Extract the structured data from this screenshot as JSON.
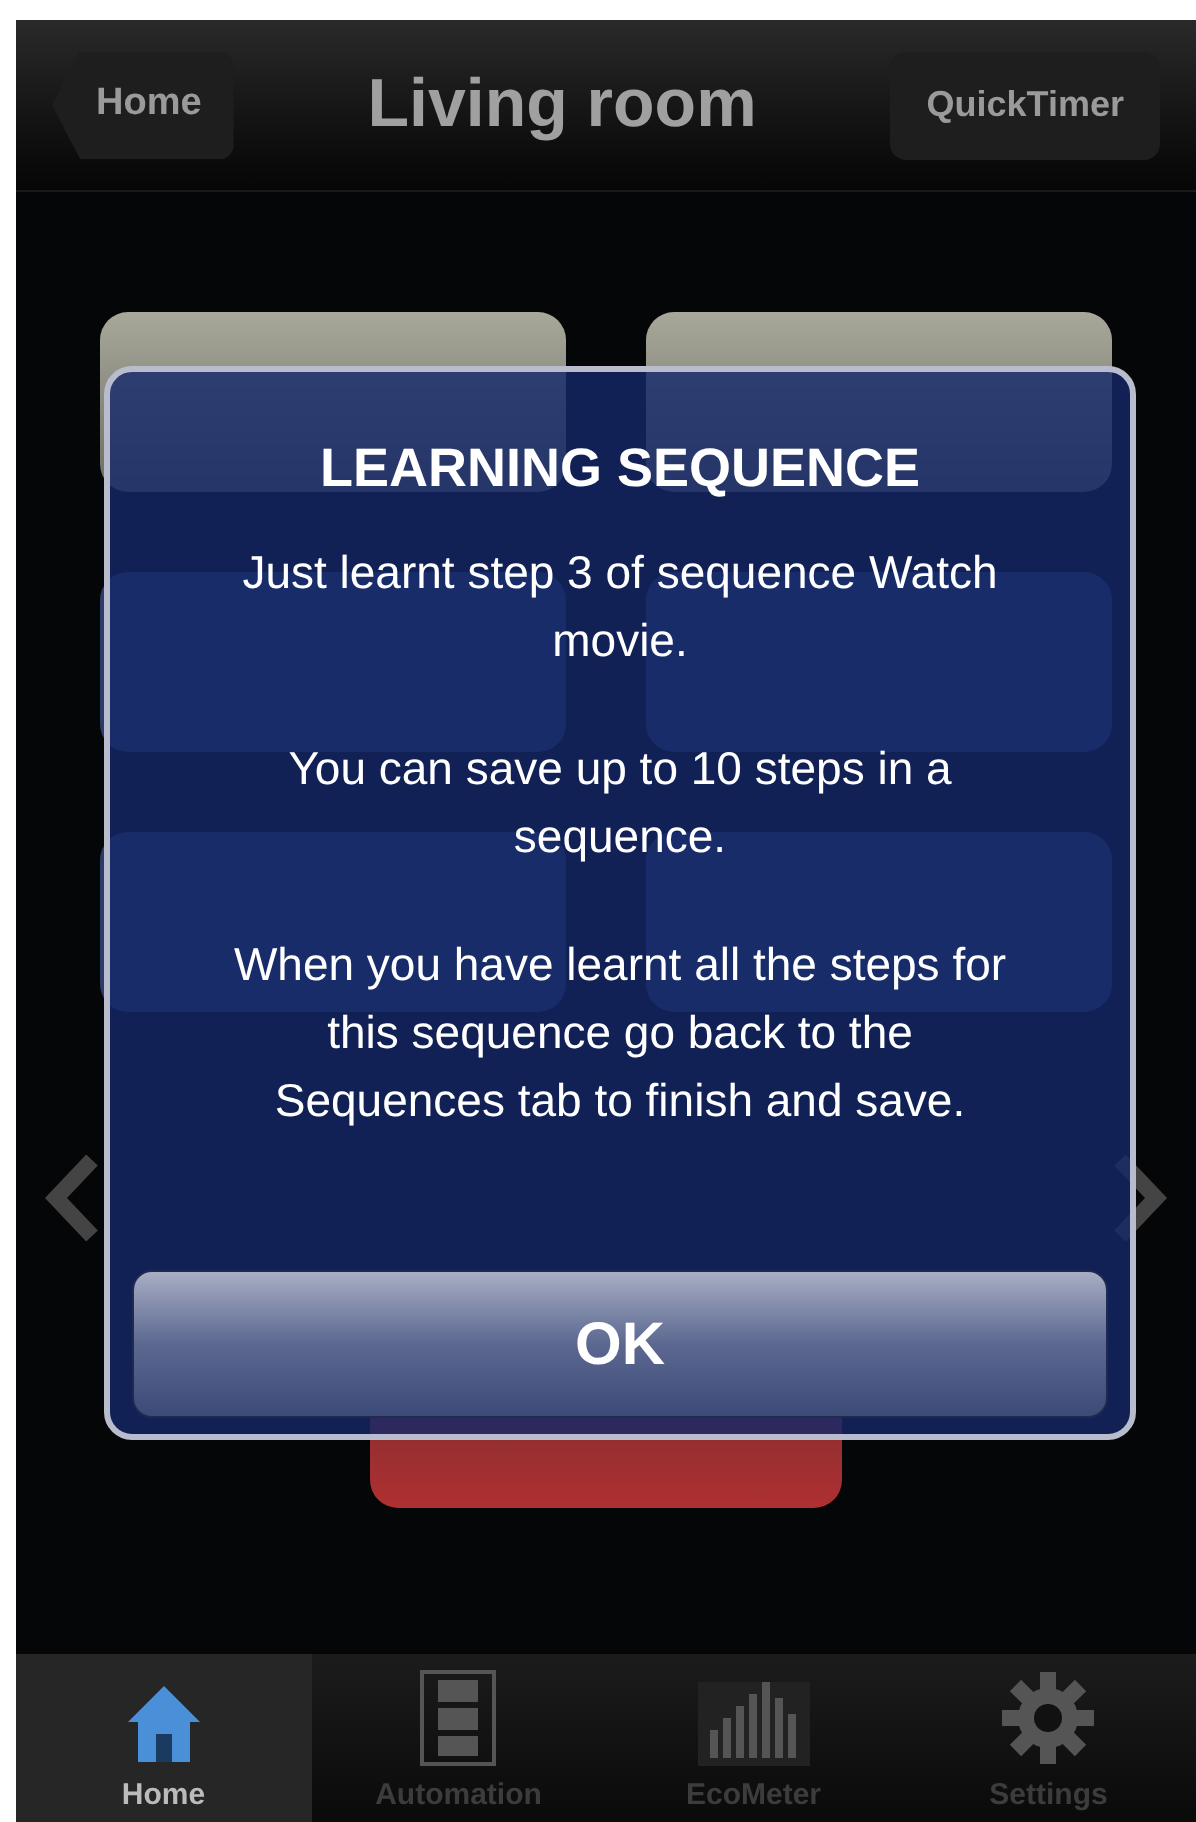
{
  "nav_bar": {
    "back_button": "Home",
    "title": "Living room",
    "right_button": "QuickTimer"
  },
  "devices": [
    {
      "kind": "lit"
    },
    {
      "kind": "lit"
    },
    {
      "kind": "plain"
    },
    {
      "kind": "plain"
    },
    {
      "kind": "plain"
    },
    {
      "kind": "plain"
    }
  ],
  "alert": {
    "title": "LEARNING SEQUENCE",
    "paragraphs": [
      "Just learnt step 3 of sequence Watch movie.",
      "You can save up to 10 steps in a sequence.",
      "When you have learnt all the steps for this sequence go back to the Sequences tab to finish and save."
    ],
    "button": "OK"
  },
  "tab_bar": [
    {
      "label": "Home",
      "selected": true
    },
    {
      "label": "Automation",
      "selected": false
    },
    {
      "label": "EcoMeter",
      "selected": false
    },
    {
      "label": "Settings",
      "selected": false
    }
  ]
}
